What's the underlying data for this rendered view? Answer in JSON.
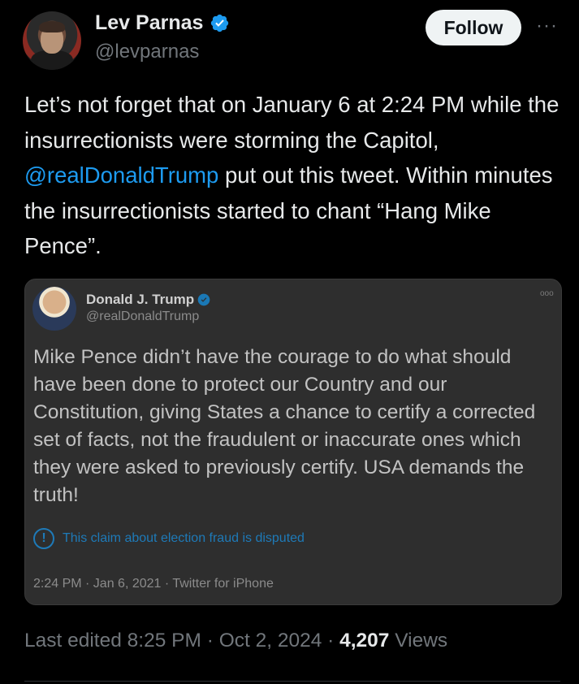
{
  "author": {
    "display_name": "Lev Parnas",
    "handle": "@levparnas",
    "verified_icon": "verified-badge-icon"
  },
  "actions": {
    "follow_label": "Follow",
    "more_label": "···"
  },
  "tweet": {
    "text_before_mention": "Let’s not forget that on January 6 at 2:24 PM while the insurrectionists were storming the Capitol, ",
    "mention": "@realDonaldTrump",
    "text_after_mention": " put out this tweet. Within minutes the insurrectionists started to chant “Hang Mike Pence”."
  },
  "quoted_tweet": {
    "display_name": "Donald J. Trump",
    "handle": "@realDonaldTrump",
    "more_label": "ooo",
    "text": "Mike Pence didn’t have the courage to do what should have been done to protect our Country and our Constitution, giving States a chance to certify a corrected set of facts, not the fraudulent or inaccurate ones which they were asked to previously certify. USA demands the truth!",
    "notice_icon": "!",
    "notice_text": "This claim about election fraud is disputed",
    "meta": "2:24 PM · Jan 6, 2021 · Twitter for iPhone"
  },
  "footer": {
    "edited_text": "Last edited 8:25 PM · Oct 2, 2024 · ",
    "views_count": "4,207",
    "views_label": " Views"
  },
  "colors": {
    "background": "#000000",
    "accent_blue": "#1d9bf0",
    "verified_blue": "#1d9bf0",
    "muted_text": "#71767b"
  }
}
